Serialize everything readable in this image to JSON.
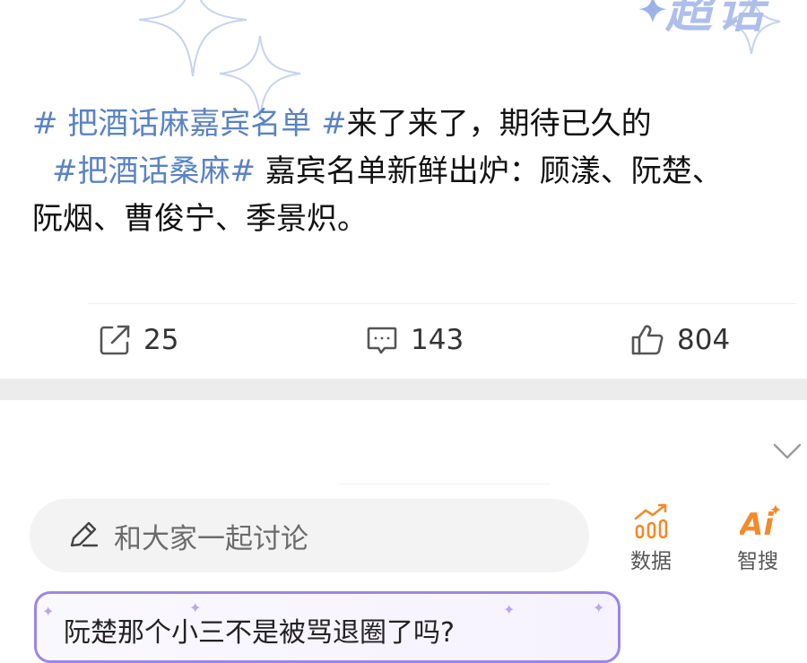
{
  "banner": {
    "partial_text": "超话"
  },
  "post": {
    "lines": [
      {
        "hashtag": "# 把酒话麻嘉宾名单 #",
        "text": "来了来了，期待已久的"
      },
      {
        "hashtag": "#把酒话桑麻#",
        "text": " 嘉宾名单新鲜出炉：顾漾、阮楚、"
      },
      {
        "hashtag": "",
        "text": "阮烟、曹俊宁、季景炽。"
      }
    ]
  },
  "actions": {
    "repost_count": "25",
    "comment_count": "143",
    "like_count": "804"
  },
  "discussion": {
    "placeholder": "和大家一起讨论"
  },
  "tools": {
    "data_label": "数据",
    "ai_label": "智搜"
  },
  "suggestion": {
    "text": "阮楚那个小三不是被骂退圈了吗?"
  },
  "colors": {
    "hashtag": "#5a83c4",
    "accent_orange": "#f28a2b",
    "card_border": "#9b86e8"
  },
  "icons": {
    "repost": "repost-icon",
    "comment": "comment-icon",
    "like": "thumbs-up-icon",
    "pencil": "pencil-icon",
    "data": "data-chart-icon",
    "ai": "ai-search-icon",
    "chevron": "chevron-down-icon"
  }
}
